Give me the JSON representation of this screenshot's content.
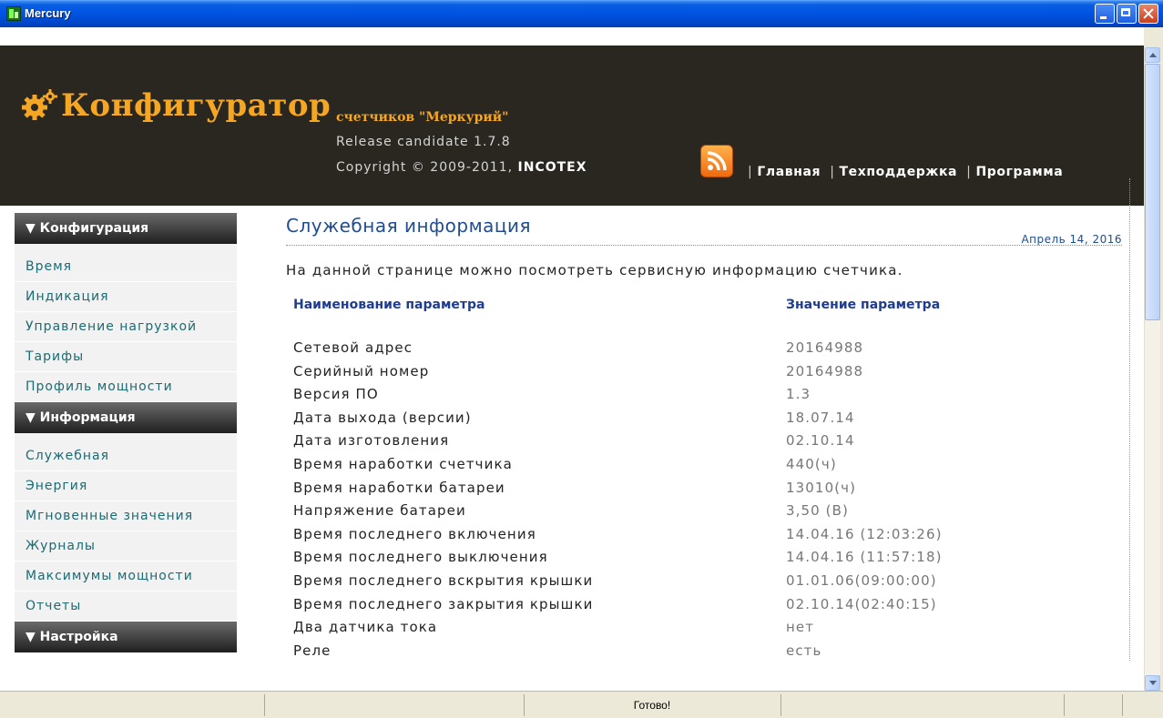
{
  "window": {
    "title": "Mercury"
  },
  "header": {
    "brand_title": "Конфигуратор",
    "brand_subtitle": "счетчиков \"Меркурий\"",
    "release": "Release candidate 1.7.8",
    "copyright_prefix": "Copyright © 2009-2011, ",
    "copyright_company": "INCOTEX",
    "nav": [
      "Главная",
      "Техподдержка",
      "Программа"
    ]
  },
  "sidebar": {
    "sections": [
      {
        "title": "▼ Конфигурация",
        "items": [
          "Время",
          "Индикация",
          "Управление нагрузкой",
          "Тарифы",
          "Профиль мощности"
        ]
      },
      {
        "title": "▼ Информация",
        "items": [
          "Служебная",
          "Энергия",
          "Мгновенные значения",
          "Журналы",
          "Максимумы мощности",
          "Отчеты"
        ]
      },
      {
        "title": "▼ Настройка",
        "items": []
      }
    ]
  },
  "main": {
    "title": "Служебная информация",
    "date": "Апрель 14, 2016",
    "intro": "На данной странице можно посмотреть сервисную информацию счетчика.",
    "col_name": "Наименование параметра",
    "col_value": "Значение параметра",
    "rows": [
      {
        "name": "Сетевой адрес",
        "value": "20164988"
      },
      {
        "name": "Серийный номер",
        "value": "20164988"
      },
      {
        "name": "Версия ПО",
        "value": "1.3"
      },
      {
        "name": "Дата выхода (версии)",
        "value": "18.07.14"
      },
      {
        "name": "Дата изготовления",
        "value": "02.10.14"
      },
      {
        "name": "Время наработки счетчика",
        "value": "440(ч)"
      },
      {
        "name": "Время наработки батареи",
        "value": "13010(ч)"
      },
      {
        "name": "Напряжение батареи",
        "value": "3,50 (В)"
      },
      {
        "name": "Время последнего включения",
        "value": "14.04.16 (12:03:26)"
      },
      {
        "name": "Время последнего выключения",
        "value": "14.04.16 (11:57:18)"
      },
      {
        "name": "Время последнего вскрытия крышки",
        "value": "01.01.06(09:00:00)"
      },
      {
        "name": "Время последнего закрытия крышки",
        "value": "02.10.14(02:40:15)"
      },
      {
        "name": "Два датчика тока",
        "value": "нет"
      },
      {
        "name": "Реле",
        "value": "есть"
      }
    ]
  },
  "statusbar": {
    "text": "Готово!"
  },
  "colors": {
    "header_bg": "#2a2720",
    "brand_orange": "#f5a623",
    "link_teal": "#1c6b73",
    "title_blue": "#1f4d8f"
  }
}
